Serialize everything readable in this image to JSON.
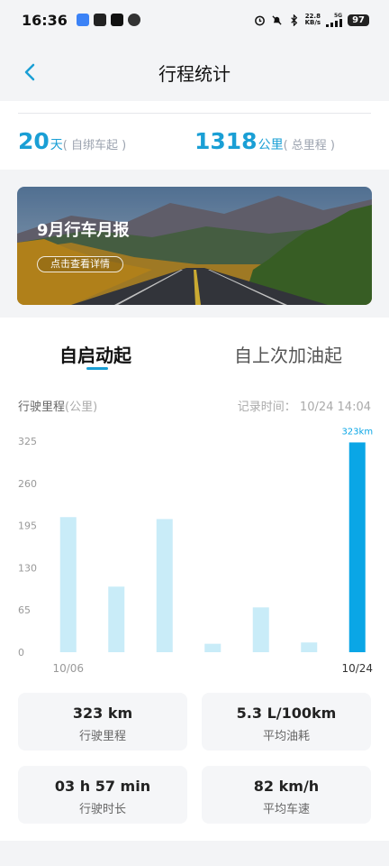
{
  "status_bar": {
    "time": "16:36",
    "speed_value": "22.8",
    "speed_unit": "KB/s",
    "network": "5G",
    "battery": "97"
  },
  "header": {
    "title": "行程统计"
  },
  "summary": {
    "days_value": "20",
    "days_unit": "天",
    "days_note": "( 自绑车起 )",
    "distance_value": "1318",
    "distance_unit": "公里",
    "distance_note": "( 总里程 )"
  },
  "banner": {
    "title": "9月行车月报",
    "button_label": "点击查看详情"
  },
  "tabs": [
    {
      "label": "自启动起",
      "active": true
    },
    {
      "label": "自上次加油起",
      "active": false
    }
  ],
  "chart": {
    "label": "行驶里程",
    "unit_note": "(公里)",
    "record_time": "记录时间： 10/24 14:04"
  },
  "chart_data": {
    "type": "bar",
    "categories": [
      "10/06",
      "",
      "",
      "",
      "",
      "",
      "10/24"
    ],
    "values": [
      208,
      101,
      205,
      13,
      69,
      15,
      323
    ],
    "highlight_index": 6,
    "highlight_label": "323km",
    "yticks": [
      0,
      65,
      130,
      195,
      260,
      325
    ],
    "ytick_labels": [
      "0",
      "65",
      "130",
      "195",
      "260",
      "325"
    ],
    "ylim": [
      0,
      325
    ],
    "xtick_labels": [
      "10/06",
      "10/24"
    ],
    "colors": {
      "bar": "#c9ecf8",
      "highlight": "#0aa6e6"
    }
  },
  "metrics": [
    {
      "value": "323 km",
      "label": "行驶里程"
    },
    {
      "value": "5.3 L/100km",
      "label": "平均油耗"
    },
    {
      "value": "03 h 57 min",
      "label": "行驶时长"
    },
    {
      "value": "82 km/h",
      "label": "平均车速"
    }
  ],
  "colors": {
    "accent": "#1a9fd5",
    "background": "#f3f4f6"
  }
}
